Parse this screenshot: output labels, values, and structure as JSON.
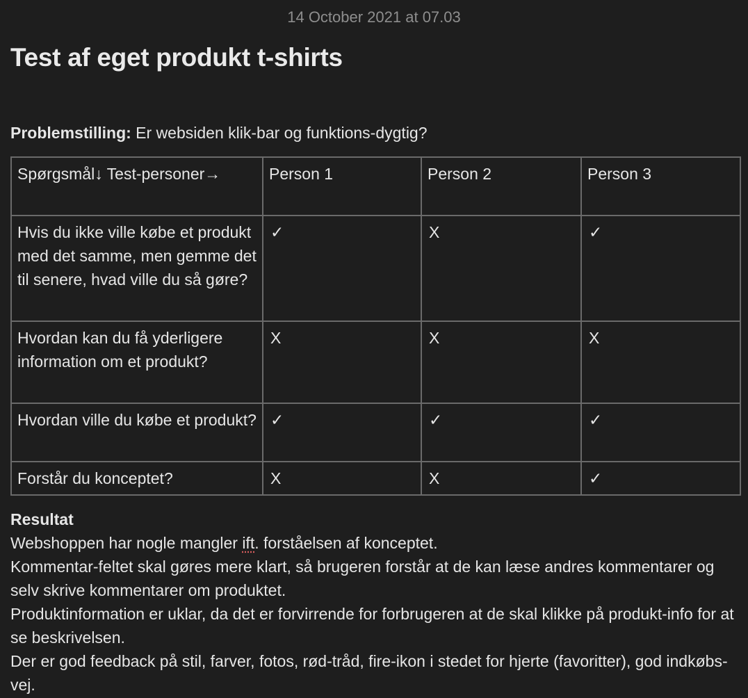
{
  "note": {
    "date": "14 October 2021 at 07.03",
    "title": "Test af eget produkt t-shirts",
    "problem": {
      "label": "Problemstilling:",
      "text": " Er websiden klik-bar og funktions-dygtig?"
    },
    "table": {
      "header": {
        "corner": "Spørgsmål↓   Test-personer→",
        "persons": [
          "Person 1",
          "Person 2",
          "Person 3"
        ]
      },
      "rows": [
        {
          "question": "Hvis du ikke ville købe et produkt med det samme, men gemme det til senere, hvad ville du så gøre?",
          "answers": [
            "✓",
            "X",
            "✓"
          ]
        },
        {
          "question": "Hvordan kan du få yderligere information om et produkt?",
          "answers": [
            "X",
            "X",
            "X"
          ]
        },
        {
          "question": "Hvordan ville du købe et produkt?",
          "answers": [
            "✓",
            "✓",
            "✓"
          ]
        },
        {
          "question": "Forstår du konceptet?",
          "answers": [
            "X",
            "X",
            "✓"
          ]
        }
      ]
    },
    "result": {
      "heading": "Resultat",
      "line1_pre": "Webshoppen har nogle mangler ",
      "line1_flag": "ift",
      "line1_post": ". forståelsen af konceptet.",
      "line2": "Kommentar-feltet skal gøres mere klart, så brugeren forstår at de kan læse andres kommentarer og selv skrive kommentarer om produktet.",
      "line3": "Produktinformation er uklar, da det er forvirrende for forbrugeren at de skal klikke på produkt-info for at se beskrivelsen.",
      "line4": "Der er god feedback på stil, farver, fotos, rød-tråd, fire-ikon i stedet for hjerte (favoritter), god indkøbs-vej."
    }
  }
}
